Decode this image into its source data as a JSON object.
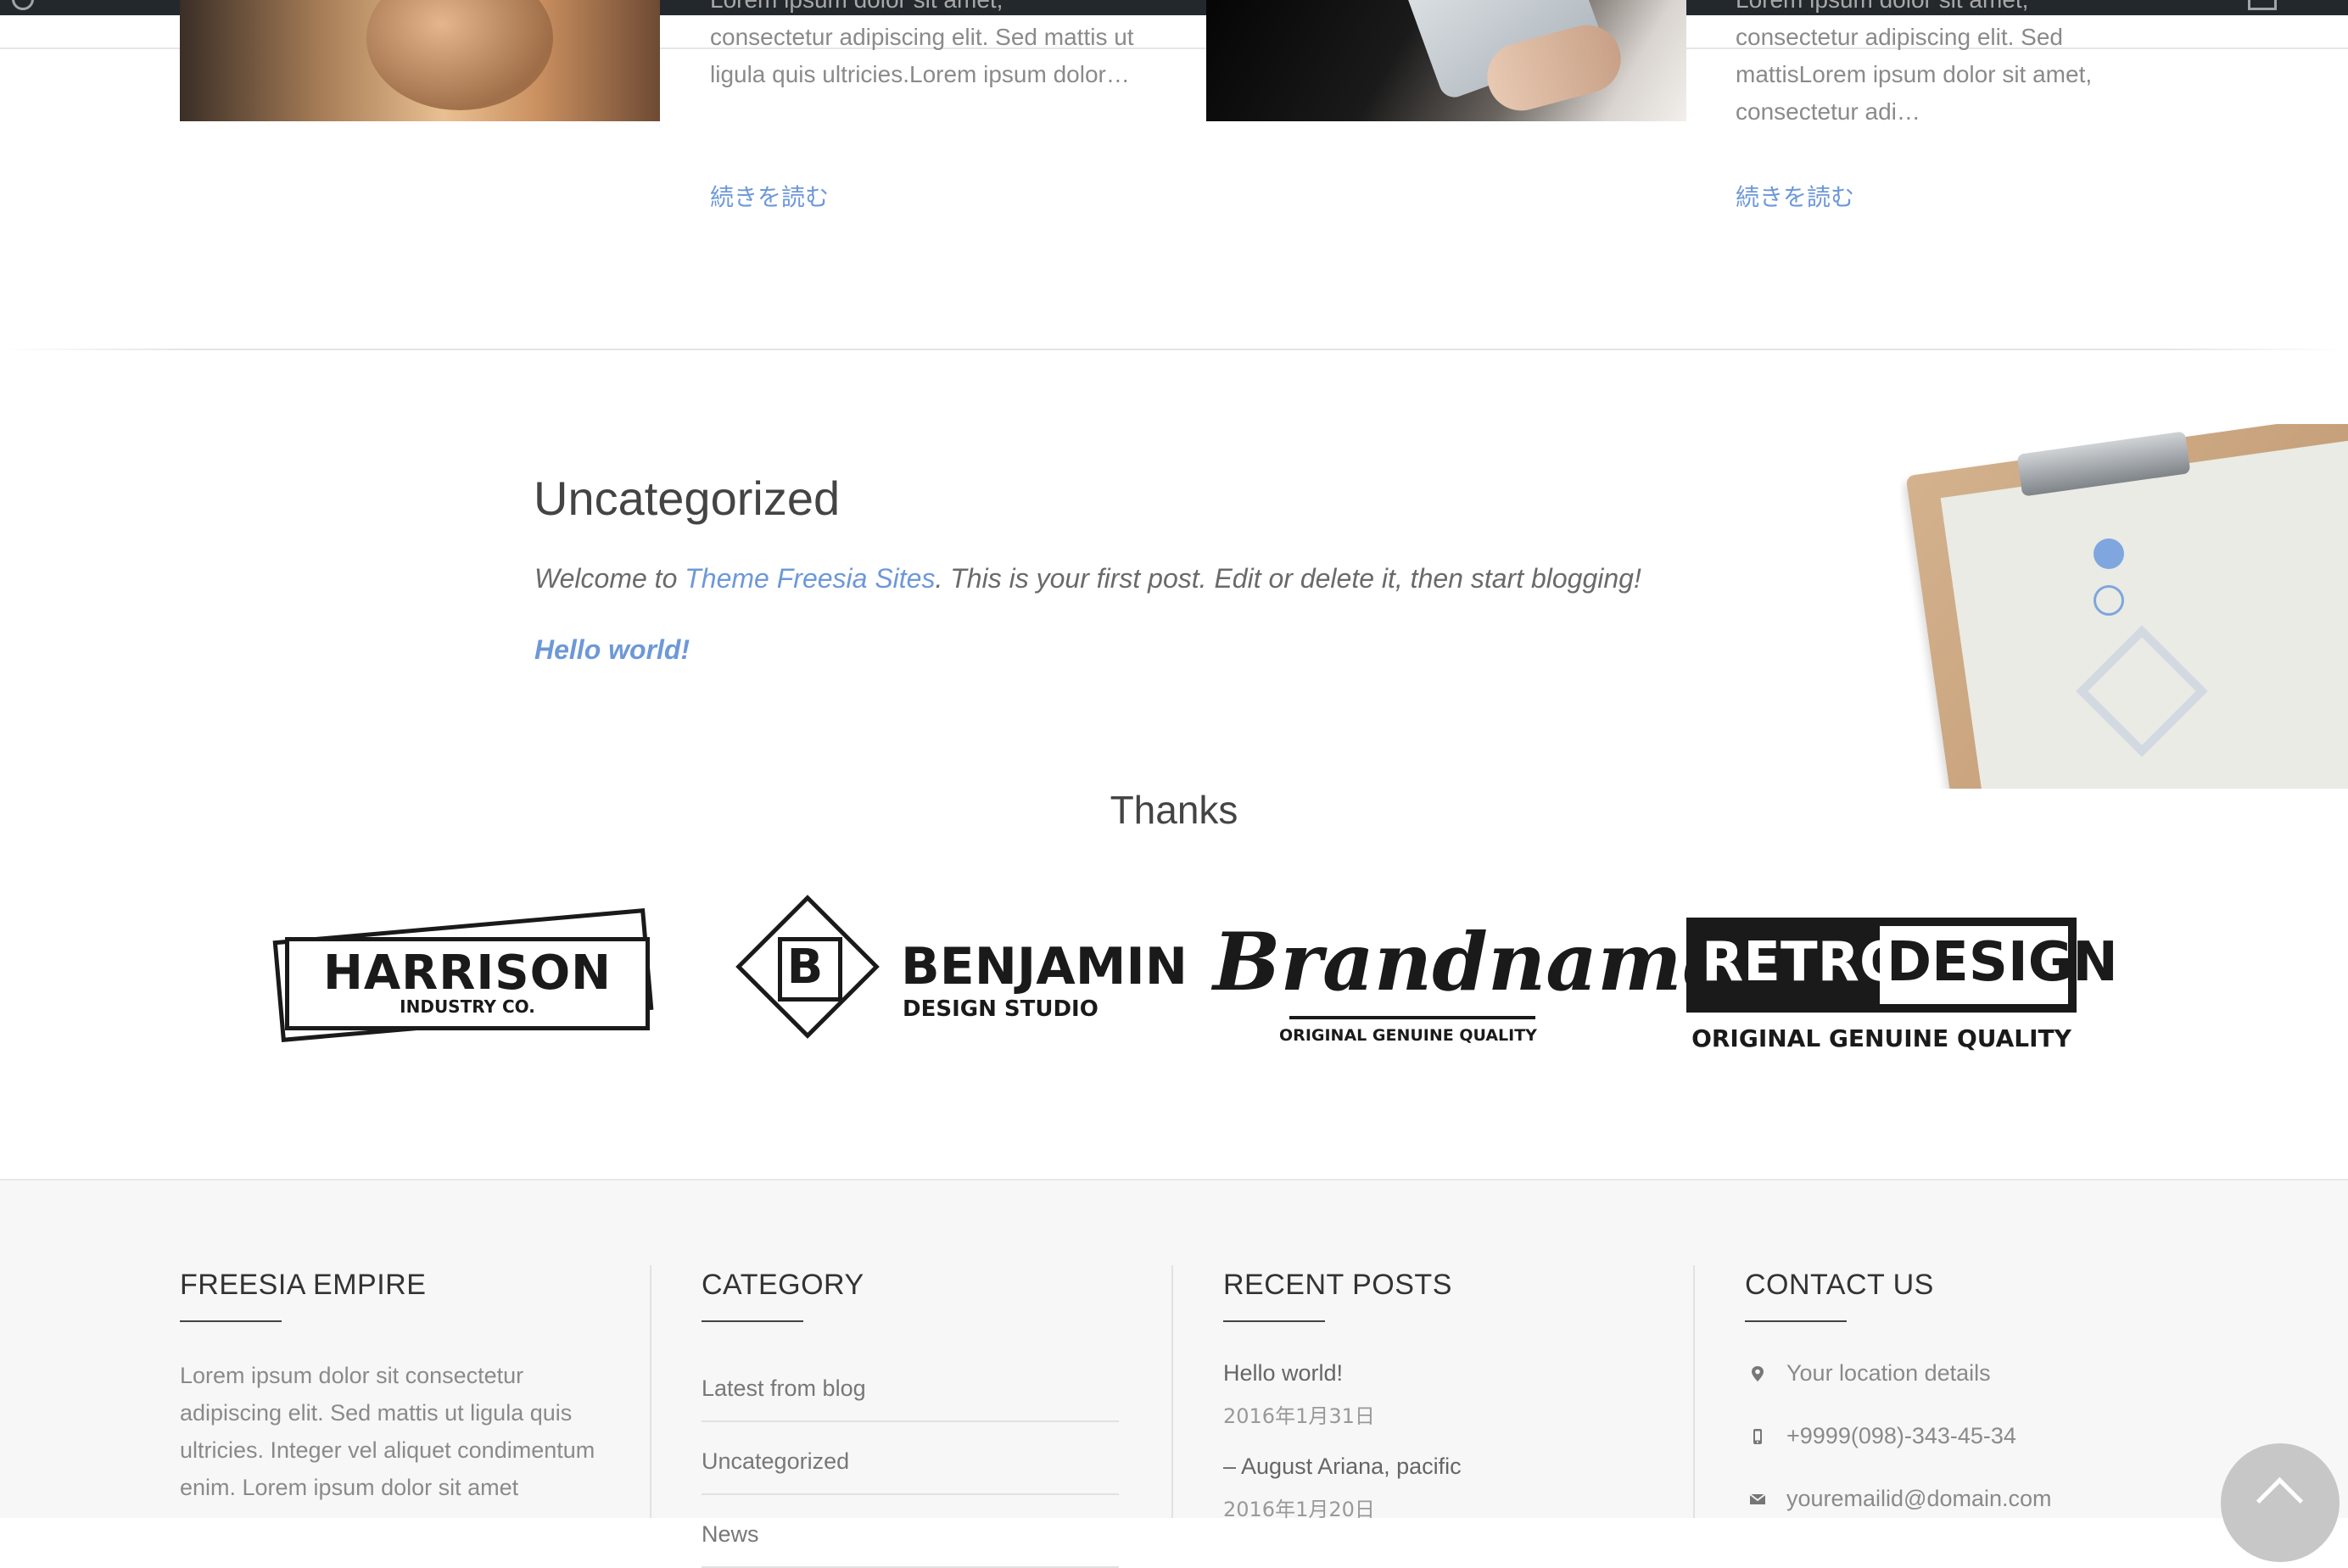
{
  "posts": [
    {
      "excerpt": "consectetur adipiscing elit. Sed mattis ut ligula quis ultricies.Lorem ipsum dolor…",
      "excerpt_top": "Lorem ipsum dolor sit amet,",
      "read_more": "続きを読む"
    },
    {
      "excerpt": "consectetur adipiscing elit. Sed mattisLorem ipsum dolor sit amet, consectetur adi…",
      "excerpt_top": "Lorem ipsum dolor sit amet,",
      "read_more": "続きを読む"
    }
  ],
  "featured": {
    "title": "Uncategorized",
    "welcome_prefix": "Welcome to ",
    "welcome_link": "Theme Freesia Sites",
    "welcome_suffix": ". This is your first post. Edit or delete it, then start blogging!",
    "post_link": "Hello world!"
  },
  "clients": {
    "title": "Thanks",
    "logos": [
      {
        "name": "HARRISON",
        "sub": "INDUSTRY CO."
      },
      {
        "letter": "B",
        "name": "BENJAMIN",
        "sub": "DESIGN STUDIO"
      },
      {
        "name": "Brandname",
        "sub": "ORIGINAL GENUINE QUALITY"
      },
      {
        "word1": "RETRO",
        "word2": "DESIGN",
        "sub": "ORIGINAL GENUINE QUALITY"
      }
    ]
  },
  "footer": {
    "about": {
      "title": "FREESIA EMPIRE",
      "text": "Lorem ipsum dolor sit consectetur adipiscing elit. Sed mattis ut ligula quis ultricies. Integer vel aliquet condimentum enim. Lorem ipsum dolor sit amet"
    },
    "category": {
      "title": "CATEGORY",
      "items": [
        "Latest from blog",
        "Uncategorized",
        "News"
      ]
    },
    "recent": {
      "title": "RECENT POSTS",
      "items": [
        {
          "title": "Hello world!",
          "date": "2016年1月31日"
        },
        {
          "title": "– August Ariana, pacific",
          "date": "2016年1月20日"
        }
      ]
    },
    "contact": {
      "title": "CONTACT US",
      "location": "Your location details",
      "phone": "+9999(098)-343-45-34",
      "email": "youremailid@domain.com"
    }
  },
  "colors": {
    "accent": "#6d98d8",
    "footer_bg": "#f7f7f7",
    "admin_bar": "#23282d"
  },
  "icons": {
    "wp": "wordpress-logo-icon",
    "location": "map-pin-icon",
    "phone": "mobile-phone-icon",
    "email": "envelope-icon",
    "back_to_top": "chevron-up-icon"
  }
}
